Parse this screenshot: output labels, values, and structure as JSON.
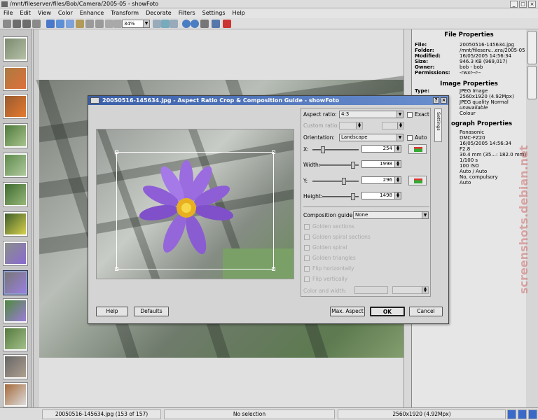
{
  "window": {
    "title": "/mnt/fileserver/files/Bob/Camera/2005-05 - showFoto",
    "minimize": "_",
    "maximize": "□",
    "close": "×"
  },
  "menu": [
    "File",
    "Edit",
    "View",
    "Color",
    "Enhance",
    "Transform",
    "Decorate",
    "Filters",
    "Settings",
    "Help"
  ],
  "toolbar": {
    "zoom": "34%"
  },
  "properties": {
    "file_heading": "File Properties",
    "file_rows": [
      {
        "k": "File:",
        "v": "20050516-145634.jpg"
      },
      {
        "k": "Folder:",
        "v": "/mnt/fileserv...era/2005-05"
      },
      {
        "k": "Modified:",
        "v": "16/05/2005 14:56:34"
      },
      {
        "k": "Size:",
        "v": "946.3 KB (969,017)"
      },
      {
        "k": "Owner:",
        "v": "bob - bob"
      },
      {
        "k": "Permissions:",
        "v": "-rwxr--r--"
      }
    ],
    "image_heading": "Image Properties",
    "image_rows": [
      {
        "k": "Type:",
        "v": "JPEG Image"
      },
      {
        "k": "",
        "v": "2560x1920 (4.92Mpx)"
      },
      {
        "k": "",
        "v": "JPEG quality Normal"
      },
      {
        "k": "",
        "v": "unavailable"
      },
      {
        "k": "",
        "v": "Colour"
      }
    ],
    "photo_heading": "ograph Properties",
    "photo_rows": [
      {
        "k": "",
        "v": "Panasonic"
      },
      {
        "k": "",
        "v": "DMC-FZ20"
      },
      {
        "k": "",
        "v": "16/05/2005 14:56:34"
      },
      {
        "k": "",
        "v": "F2.8"
      },
      {
        "k": "",
        "v": "30.4 mm (35...: 182.0 mm)"
      },
      {
        "k": "",
        "v": "1/100 s"
      },
      {
        "k": "",
        "v": "100 ISO"
      },
      {
        "k": "",
        "v": "Auto / Auto"
      },
      {
        "k": "",
        "v": "No, compulsory"
      },
      {
        "k": "",
        "v": "Auto"
      }
    ]
  },
  "dialog": {
    "title": "20050516-145634.jpg - Aspect Ratio Crop & Composition Guide - showFoto",
    "help_glyph": "?",
    "close_glyph": "×",
    "aspect_ratio_label": "Aspect ratio:",
    "aspect_ratio_value": "4:3",
    "exact_label": "Exact",
    "custom_ratio_label": "Custom ratio:",
    "orientation_label": "Orientation:",
    "orientation_value": "Landscape",
    "auto_label": "Auto",
    "x_label": "X:",
    "x_value": "254",
    "width_label": "Width:",
    "width_value": "1998",
    "y_label": "Y:",
    "y_value": "296",
    "height_label": "Height:",
    "height_value": "1498",
    "composition_label": "Composition guide:",
    "composition_value": "None",
    "guides": [
      "Golden sections",
      "Golden spiral sections",
      "Golden spiral",
      "Golden triangles",
      "Flip horizontally",
      "Flip vertically"
    ],
    "color_label": "Color and width:",
    "tab_label": "Settings",
    "buttons": {
      "help": "Help",
      "defaults": "Defaults",
      "max_aspect": "Max. Aspect",
      "ok": "OK",
      "cancel": "Cancel"
    }
  },
  "status": {
    "file": "20050516-145634.jpg (153 of 157)",
    "selection": "No selection",
    "size": "2560x1920 (4.92Mpx)"
  },
  "watermark": "screenshots.debian.net"
}
